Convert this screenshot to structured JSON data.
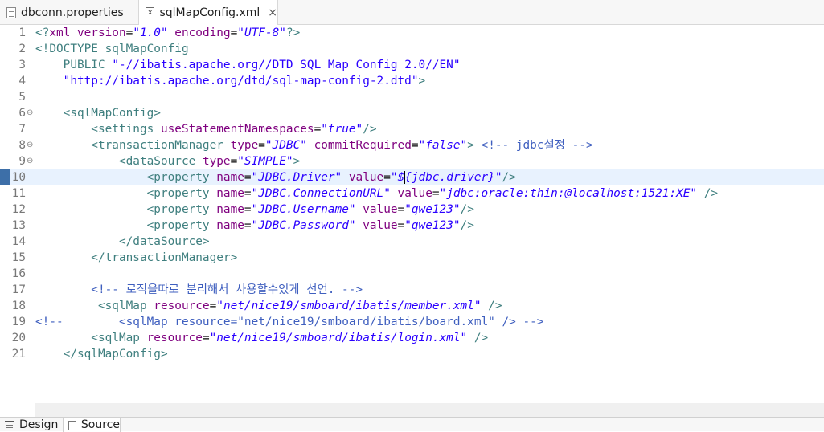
{
  "tabs": [
    {
      "label": "dbconn.properties",
      "icon": "properties-file-icon"
    },
    {
      "label": "sqlMapConfig.xml",
      "icon": "xml-file-icon",
      "close": "×"
    }
  ],
  "editor": {
    "lines": [
      {
        "n": "1",
        "fold": "",
        "tokens": [
          [
            "tg",
            "<?"
          ],
          [
            "an",
            "xml "
          ],
          [
            "an",
            "version"
          ],
          [
            "",
            "="
          ],
          [
            "av",
            "\"1.0\""
          ],
          [
            "",
            ""
          ],
          [
            "an",
            " encoding"
          ],
          [
            "",
            "="
          ],
          [
            "av",
            "\"UTF-8\""
          ],
          [
            "tg",
            "?>"
          ]
        ]
      },
      {
        "n": "2",
        "fold": "",
        "tokens": [
          [
            "tg",
            "<!DOCTYPE sqlMapConfig"
          ]
        ]
      },
      {
        "n": "3",
        "fold": "",
        "tokens": [
          [
            "tg",
            "    PUBLIC "
          ],
          [
            "str",
            "\"-//ibatis.apache.org//DTD SQL Map Config 2.0//EN\""
          ]
        ]
      },
      {
        "n": "4",
        "fold": "",
        "tokens": [
          [
            "str",
            "    \"http://ibatis.apache.org/dtd/sql-map-config-2.dtd\""
          ],
          [
            "tg",
            ">"
          ]
        ]
      },
      {
        "n": "5",
        "fold": "",
        "tokens": []
      },
      {
        "n": "6",
        "fold": "⊖",
        "tokens": [
          [
            "tg",
            "    <sqlMapConfig>"
          ]
        ]
      },
      {
        "n": "7",
        "fold": "",
        "tokens": [
          [
            "tg",
            "        <settings "
          ],
          [
            "an",
            "useStatementNamespaces"
          ],
          [
            "",
            "="
          ],
          [
            "av",
            "\"true\""
          ],
          [
            "tg",
            "/>"
          ]
        ]
      },
      {
        "n": "8",
        "fold": "⊖",
        "tokens": [
          [
            "tg",
            "        <transactionManager "
          ],
          [
            "an",
            "type"
          ],
          [
            "",
            "="
          ],
          [
            "av",
            "\"JDBC\""
          ],
          [
            "an",
            " commitRequired"
          ],
          [
            "",
            "="
          ],
          [
            "av",
            "\"false\""
          ],
          [
            "tg",
            ">"
          ],
          [
            "cm",
            " <!-- jdbc설정 -->"
          ]
        ]
      },
      {
        "n": "9",
        "fold": "⊖",
        "tokens": [
          [
            "tg",
            "            <dataSource "
          ],
          [
            "an",
            "type"
          ],
          [
            "",
            "="
          ],
          [
            "av",
            "\"SIMPLE\""
          ],
          [
            "tg",
            ">"
          ]
        ]
      },
      {
        "n": "10",
        "fold": "",
        "current": true,
        "tokens": [
          [
            "tg",
            "                <property "
          ],
          [
            "an",
            "name"
          ],
          [
            "",
            "="
          ],
          [
            "av",
            "\"JDBC.Driver\""
          ],
          [
            "an",
            " value"
          ],
          [
            "",
            "="
          ],
          [
            "av",
            "\"$"
          ],
          [
            "caret",
            ""
          ],
          [
            "av",
            "{jdbc.driver}\""
          ],
          [
            "tg",
            "/>"
          ]
        ]
      },
      {
        "n": "11",
        "fold": "",
        "tokens": [
          [
            "tg",
            "                <property "
          ],
          [
            "an",
            "name"
          ],
          [
            "",
            "="
          ],
          [
            "av",
            "\"JDBC.ConnectionURL\""
          ],
          [
            "an",
            " value"
          ],
          [
            "",
            "="
          ],
          [
            "av",
            "\"jdbc:oracle:thin:@localhost:1521:XE\""
          ],
          [
            "tg",
            " />"
          ]
        ]
      },
      {
        "n": "12",
        "fold": "",
        "tokens": [
          [
            "tg",
            "                <property "
          ],
          [
            "an",
            "name"
          ],
          [
            "",
            "="
          ],
          [
            "av",
            "\"JDBC.Username\""
          ],
          [
            "an",
            " value"
          ],
          [
            "",
            "="
          ],
          [
            "av",
            "\"qwe123\""
          ],
          [
            "tg",
            "/>"
          ]
        ]
      },
      {
        "n": "13",
        "fold": "",
        "tokens": [
          [
            "tg",
            "                <property "
          ],
          [
            "an",
            "name"
          ],
          [
            "",
            "="
          ],
          [
            "av",
            "\"JDBC.Password\""
          ],
          [
            "an",
            " value"
          ],
          [
            "",
            "="
          ],
          [
            "av",
            "\"qwe123\""
          ],
          [
            "tg",
            "/>"
          ]
        ]
      },
      {
        "n": "14",
        "fold": "",
        "tokens": [
          [
            "tg",
            "            </dataSource>"
          ]
        ]
      },
      {
        "n": "15",
        "fold": "",
        "tokens": [
          [
            "tg",
            "        </transactionManager>"
          ]
        ]
      },
      {
        "n": "16",
        "fold": "",
        "tokens": []
      },
      {
        "n": "17",
        "fold": "",
        "tokens": [
          [
            "cm",
            "        <!-- 로직을따로 분리해서 사용할수있게 선언. -->"
          ]
        ]
      },
      {
        "n": "18",
        "fold": "",
        "tokens": [
          [
            "tg",
            "         <sqlMap "
          ],
          [
            "an",
            "resource"
          ],
          [
            "",
            "="
          ],
          [
            "av",
            "\"net/nice19/smboard/ibatis/member.xml\""
          ],
          [
            "tg",
            " />"
          ]
        ]
      },
      {
        "n": "19",
        "fold": "",
        "tokens": [
          [
            "cm",
            "<!--        <sqlMap resource=\"net/nice19/smboard/ibatis/board.xml\" /> -->"
          ]
        ]
      },
      {
        "n": "20",
        "fold": "",
        "tokens": [
          [
            "tg",
            "        <sqlMap "
          ],
          [
            "an",
            "resource"
          ],
          [
            "",
            "="
          ],
          [
            "av",
            "\"net/nice19/smboard/ibatis/login.xml\""
          ],
          [
            "tg",
            " />"
          ]
        ]
      },
      {
        "n": "21",
        "fold": "",
        "tokens": [
          [
            "tg",
            "    </sqlMapConfig>"
          ]
        ]
      }
    ]
  },
  "bottom_tabs": [
    {
      "label": "Design",
      "icon": "design-view-icon"
    },
    {
      "label": "Source",
      "icon": "source-view-icon"
    }
  ],
  "colors": {
    "tag": "#3f7f7f",
    "attr": "#7f007f",
    "value": "#2a00ff",
    "comment": "#3f5fbf",
    "current_line": "#e8f2fe"
  }
}
